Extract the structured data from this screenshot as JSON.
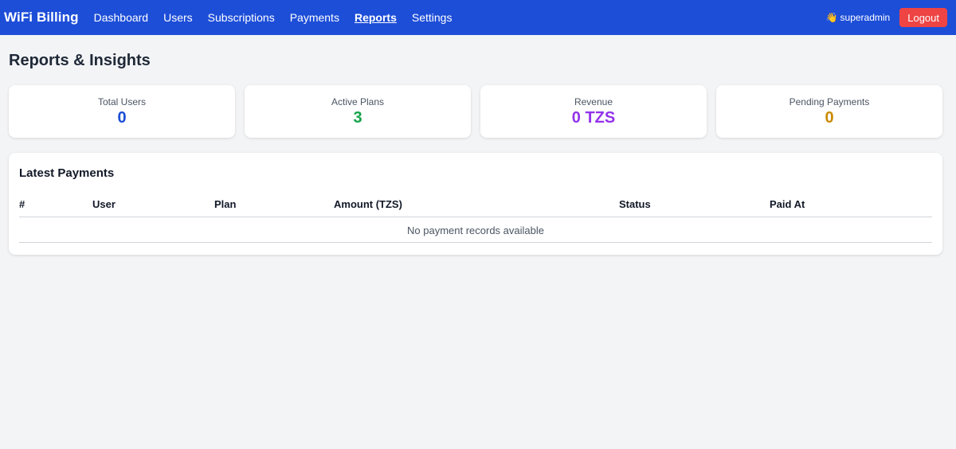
{
  "navbar": {
    "brand": "WiFi Billing",
    "links": [
      "Dashboard",
      "Users",
      "Subscriptions",
      "Payments",
      "Reports",
      "Settings"
    ],
    "active": "Reports",
    "user_icon": "👋",
    "username": "superadmin",
    "logout_label": "Logout"
  },
  "page": {
    "title": "Reports & Insights"
  },
  "stats": [
    {
      "label": "Total Users",
      "value": "0",
      "color": "#1d4ed8"
    },
    {
      "label": "Active Plans",
      "value": "3",
      "color": "#16a34a"
    },
    {
      "label": "Revenue",
      "value": "0 TZS",
      "color": "#9333ea"
    },
    {
      "label": "Pending Payments",
      "value": "0",
      "color": "#ca8a04"
    }
  ],
  "payments": {
    "title": "Latest Payments",
    "columns": [
      "#",
      "User",
      "Plan",
      "Amount (TZS)",
      "Status",
      "Paid At"
    ],
    "empty_message": "No payment records available"
  }
}
